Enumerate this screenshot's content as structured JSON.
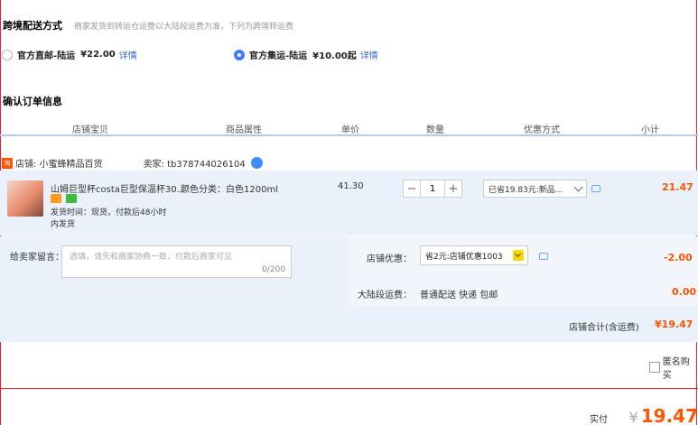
{
  "shipping": {
    "title": "跨境配送方式",
    "note": "商家发货到转运仓运费以大陆段运费为准，下列为跨境转运费",
    "option1": {
      "label": "官方直邮-陆运",
      "price": "¥22.00",
      "detail": "详情",
      "selected": false
    },
    "option2": {
      "label": "官方集运-陆运",
      "price": "¥10.00起",
      "detail": "详情",
      "selected": true
    }
  },
  "confirm": {
    "title": "确认订单信息",
    "columns": [
      "店铺宝贝",
      "商品属性",
      "单价",
      "数量",
      "优惠方式",
      "小计"
    ]
  },
  "shop": {
    "tag": "淘",
    "shop_label": "店铺: 小蜜蜂精品百货",
    "seller_label": "卖家: tb378744026104"
  },
  "item": {
    "title": "山姆巨型杯costa巨型保温杯30...",
    "attr": "颜色分类：白色1200ml",
    "ship_time": "发货时间：现货，付款后48小时",
    "ship_time2": "内发货",
    "price": "41.30",
    "quantity": "1",
    "minus": "−",
    "plus": "+",
    "discount": "已省19.83元:新品...",
    "subtotal": "21.47"
  },
  "message": {
    "label": "给卖家留言：",
    "placeholder": "选填，请先和商家协商一致，付款后商家可见",
    "counter": "0/200"
  },
  "store_discount": {
    "label": "店铺优惠：",
    "value": "省2元:店铺优惠1003",
    "amount": "-2.00"
  },
  "mainland": {
    "label": "大陆段运费：",
    "value": "普通配送 快递 包邮",
    "amount": "0.00"
  },
  "shop_total": {
    "label": "店铺合计(含运费)",
    "amount": "¥19.47"
  },
  "anonymous": {
    "label": "匿名购买"
  },
  "payment": {
    "label": "实付款：",
    "currency": "¥",
    "amount": "19.47"
  },
  "colors": {
    "accent": "#ff5500",
    "link": "#3366cc",
    "panel": "#eaf1fb",
    "border_red": "#e8232e"
  }
}
